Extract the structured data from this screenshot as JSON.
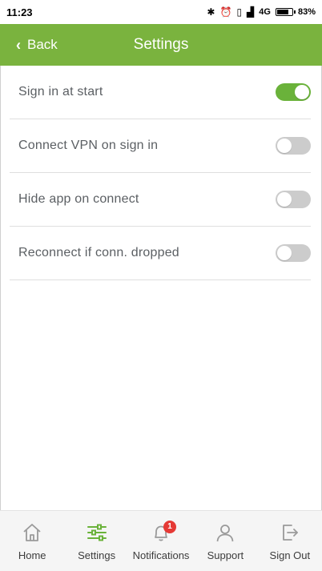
{
  "status_bar": {
    "time": "11:23",
    "network": "4G",
    "battery_percent": "83%",
    "battery_level": 0.83,
    "icons": [
      "bluetooth-icon",
      "alarm-icon",
      "vibrate-icon",
      "signal-icon",
      "battery-icon"
    ]
  },
  "header": {
    "back_label": "Back",
    "title": "Settings",
    "color": "#7ab33e"
  },
  "settings": {
    "items": [
      {
        "label": "Sign in at start",
        "on": true
      },
      {
        "label": "Connect VPN on sign in",
        "on": false
      },
      {
        "label": "Hide app on connect",
        "on": false
      },
      {
        "label": "Reconnect if conn. dropped",
        "on": false
      }
    ]
  },
  "nav": {
    "items": [
      {
        "label": "Home",
        "icon": "home-icon"
      },
      {
        "label": "Settings",
        "icon": "sliders-icon",
        "active": true
      },
      {
        "label": "Notifications",
        "icon": "bell-icon",
        "badge": "1"
      },
      {
        "label": "Support",
        "icon": "person-icon"
      },
      {
        "label": "Sign Out",
        "icon": "sign-out-icon"
      }
    ],
    "active_color": "#6ab23a",
    "badge_color": "#e53935"
  }
}
